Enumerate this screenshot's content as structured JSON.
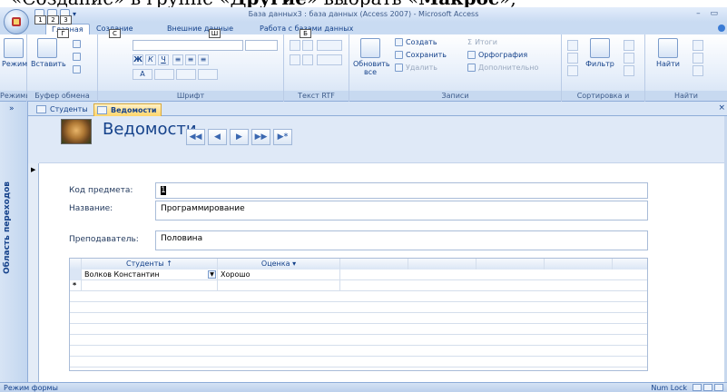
{
  "caption": {
    "pre": "«Создание» в группе «",
    "bold": "Другие",
    "mid": "» выбрать «",
    "bold2": "Макрос",
    "post": "»,"
  },
  "window": {
    "title": "База данных3 : база данных (Access 2007) - Microsoft Access",
    "controls": "– ▭"
  },
  "ribbon_tabs": [
    {
      "label": "Главная",
      "keytip": "Г"
    },
    {
      "label": "Создание",
      "keytip": "С"
    },
    {
      "label": "Внешние данные",
      "keytip": "Ш"
    },
    {
      "label": "Работа с базами данных",
      "keytip": "Б"
    }
  ],
  "qat_keytips": [
    "1",
    "2",
    "3"
  ],
  "groups": {
    "views": {
      "label": "Режимы",
      "button": "Режим"
    },
    "clipboard": {
      "label": "Буфер обмена",
      "paste": "Вставить"
    },
    "font": {
      "label": "Шрифт",
      "bold": "Ж",
      "italic": "К",
      "underline": "Ч"
    },
    "rtf": {
      "label": "Текст RTF"
    },
    "records": {
      "label": "Записи",
      "refresh": "Обновить все",
      "new": "Создать",
      "save": "Сохранить",
      "delete": "Удалить",
      "totals": "Итоги",
      "spelling": "Орфография",
      "more": "Дополнительно"
    },
    "sort": {
      "label": "Сортировка и фильтр",
      "filter": "Фильтр"
    },
    "find": {
      "label": "Найти",
      "find": "Найти"
    }
  },
  "navpane": {
    "toggle": "»",
    "title": "Область переходов"
  },
  "doc_tabs": [
    {
      "label": "Студенты",
      "active": false
    },
    {
      "label": "Ведомости",
      "active": true
    }
  ],
  "doc_close": "×",
  "form": {
    "title": "Ведомости",
    "nav_buttons": [
      "◀◀",
      "◀",
      "▶",
      "▶▶",
      "▶*"
    ],
    "fields": [
      {
        "label": "Код предмета:",
        "value": "1"
      },
      {
        "label": "Название:",
        "value": "Программирование"
      },
      {
        "label": "Преподаватель:",
        "value": "Половина"
      }
    ]
  },
  "subform": {
    "columns": [
      "Студенты",
      "Оценка"
    ],
    "rows": [
      {
        "student": "Волков Константин",
        "grade": "Хорошо"
      }
    ],
    "new_row_marker": "*"
  },
  "status": {
    "left": "Режим формы",
    "right": "Num Lock"
  }
}
